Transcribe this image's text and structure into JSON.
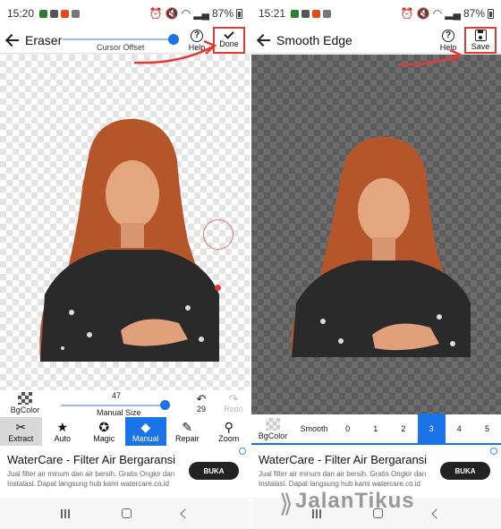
{
  "left": {
    "status": {
      "time": "15:20",
      "battery": "87%"
    },
    "toolbar": {
      "title": "Eraser",
      "slider_caption": "Cursor Offset",
      "help_label": "Help",
      "done_label": "Done"
    },
    "controls": {
      "bg_label": "BgColor",
      "size_value": "47",
      "size_caption": "Manual Size",
      "undo_count": "29",
      "redo_label": "Redo"
    },
    "tools": [
      {
        "label": "Extract",
        "icon": "scissors-icon",
        "glyph": "✂"
      },
      {
        "label": "Auto",
        "icon": "star-icon",
        "glyph": "★"
      },
      {
        "label": "Magic",
        "icon": "magic-star-icon",
        "glyph": "✪"
      },
      {
        "label": "Manual",
        "icon": "eraser-icon",
        "glyph": "◆"
      },
      {
        "label": "Repair",
        "icon": "brush-icon",
        "glyph": "✎"
      },
      {
        "label": "Zoom",
        "icon": "zoom-icon",
        "glyph": "⚲"
      }
    ],
    "ad": {
      "title": "WaterCare - Filter Air Bergaransi",
      "desc": "Jual filter air minum dan air bersih. Gratis Ongkir dan Instalasi. Dapat langsung hub kami watercare.co.id",
      "button": "BUKA"
    }
  },
  "right": {
    "status": {
      "time": "15:21",
      "battery": "87%"
    },
    "toolbar": {
      "title": "Smooth Edge",
      "help_label": "Help",
      "save_label": "Save"
    },
    "smooth": {
      "bg_label": "BgColor",
      "label": "Smooth",
      "options": [
        "0",
        "1",
        "2",
        "3",
        "4",
        "5"
      ],
      "selected": "3"
    },
    "ad": {
      "title": "WaterCare - Filter Air Bergaransi",
      "desc": "Jual filter air minum dan air bersih. Gratis Ongkir dan Instalasi. Dapat langsung hub kami watercare.co.id",
      "button": "BUKA"
    }
  },
  "watermark": "JalanTikus",
  "colors": {
    "accent": "#1a73e8",
    "highlight": "#e53935"
  }
}
